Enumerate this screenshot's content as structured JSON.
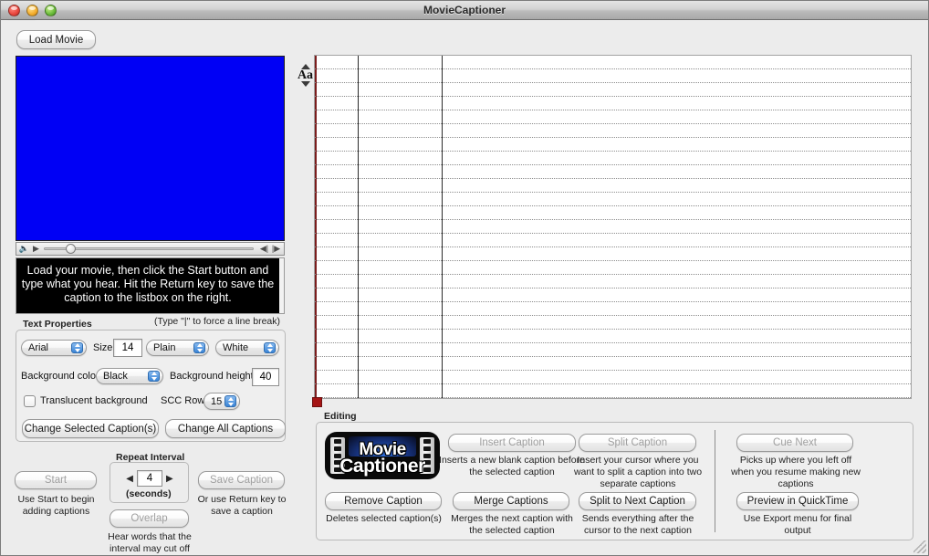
{
  "window": {
    "title": "MovieCaptioner",
    "traffic_lights": [
      "close-button",
      "minimize-button",
      "zoom-button"
    ]
  },
  "left_panel": {
    "load_movie_label": "Load Movie",
    "movie_color": "#0000f5",
    "transport": {
      "volume_icon": "speaker-icon",
      "play_icon": "play-icon",
      "step_back_icon": "step-back-icon",
      "step_forward_icon": "step-forward-icon"
    },
    "caption_preview_text": "Load your movie, then click the Start button and type what you hear. Hit the Return key to save the caption to the listbox on the right.",
    "line_break_hint": "(Type  \"|\" to force a line break)"
  },
  "text_properties": {
    "group_label": "Text Properties",
    "font": "Arial",
    "size_label": "Size:",
    "size_value": "14",
    "style": "Plain",
    "text_color": "White",
    "background_color_label": "Background color",
    "background_color": "Black",
    "background_height_label": "Background height",
    "background_height": "40",
    "translucent_label": "Translucent background",
    "translucent_checked": false,
    "scc_row_label": "SCC Row:",
    "scc_row_value": "15",
    "change_label": "Change",
    "change_selected_label": "Change Selected Caption(s)",
    "change_all_label": "Change All Captions"
  },
  "capture_controls": {
    "repeat_interval_label": "Repeat Interval",
    "repeat_interval_value": "4",
    "seconds_label": "(seconds)",
    "start_label": "Start",
    "start_note": "Use Start to begin adding captions",
    "save_caption_label": "Save Caption",
    "save_caption_note": "Or use Return key to save a caption",
    "overlap_label": "Overlap",
    "overlap_note": "Hear words that the interval may cut off",
    "left_arrow_icon": "arrow-left-icon",
    "right_arrow_icon": "arrow-right-icon"
  },
  "caption_list": {
    "row_count": 25,
    "column_dividers": [
      47,
      139
    ],
    "text_size_widget": {
      "label": "Aa",
      "increase_icon": "triangle-up-icon",
      "decrease_icon": "triangle-down-icon"
    },
    "marker_color": "#a51414",
    "rail_color": "#7b1d1d"
  },
  "editing": {
    "group_label": "Editing",
    "logo": {
      "line1": "Movie",
      "line2": "Captioner"
    },
    "buttons": [
      {
        "label": "Insert Caption",
        "note": "Inserts a new blank caption before the selected caption"
      },
      {
        "label": "Split Caption",
        "note": "Insert your cursor where you want to split a caption into two separate captions"
      },
      {
        "label": "Cue Next",
        "note": "Picks up where you left off when you resume making new captions"
      },
      {
        "label": "Remove Caption",
        "note": "Deletes selected caption(s)"
      },
      {
        "label": "Merge Captions",
        "note": "Merges the next caption with the selected caption"
      },
      {
        "label": "Split to Next Caption",
        "note": "Sends everything after the cursor to the next caption"
      },
      {
        "label": "Preview in QuickTime",
        "note": "Use Export menu for final output"
      }
    ]
  },
  "colors": {
    "window_background": "#ececec",
    "titlebar": "#c8c8c8",
    "accent_blue": "#3b85d6",
    "movie_blue": "#0000f5"
  }
}
